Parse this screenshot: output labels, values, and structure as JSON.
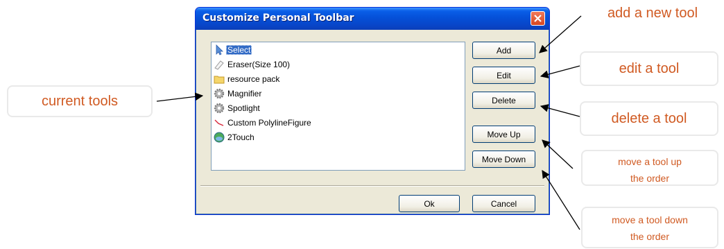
{
  "dialog": {
    "title": "Customize Personal Toolbar",
    "tools": [
      {
        "label": "Select",
        "icon": "cursor-arrow-icon",
        "selected": true
      },
      {
        "label": "Eraser(Size 100)",
        "icon": "eraser-icon",
        "selected": false
      },
      {
        "label": "resource pack",
        "icon": "folder-icon",
        "selected": false
      },
      {
        "label": "Magnifier",
        "icon": "gear-icon",
        "selected": false
      },
      {
        "label": "Spotlight",
        "icon": "gear-icon",
        "selected": false
      },
      {
        "label": "Custom PolylineFigure",
        "icon": "polyline-icon",
        "selected": false
      },
      {
        "label": "2Touch",
        "icon": "globe-icon",
        "selected": false
      }
    ],
    "buttons": {
      "add": "Add",
      "edit": "Edit",
      "delete": "Delete",
      "move_up": "Move Up",
      "move_down": "Move Down",
      "ok": "Ok",
      "cancel": "Cancel"
    }
  },
  "annotations": {
    "current_tools": "current tools",
    "add": "add a new tool",
    "edit": "edit a tool",
    "delete": "delete a tool",
    "move_up_line1": "move a tool up",
    "move_up_line2": "the order",
    "move_down_line1": "move a tool down",
    "move_down_line2": "the order"
  },
  "colors": {
    "callout_text": "#d05a22",
    "selection": "#316ac5",
    "titlebar": "#0550d8"
  }
}
